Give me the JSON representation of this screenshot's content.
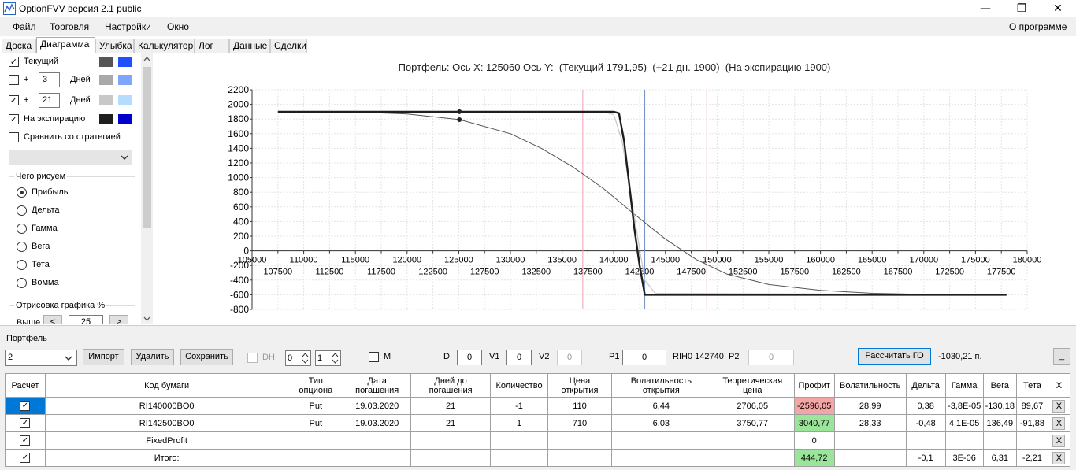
{
  "window": {
    "title": "OptionFVV версия 2.1 public",
    "min": "—",
    "max": "❐",
    "close": "✕"
  },
  "menu": {
    "items": [
      "Файл",
      "Торговля",
      "Настройки",
      "Окно"
    ],
    "about": "О программе"
  },
  "tabs": [
    "Доска",
    "Диаграмма",
    "Улыбка",
    "Калькулятор",
    "Лог",
    "Данные",
    "Сделки"
  ],
  "active_tab": "Диаграмма",
  "left": {
    "current_label": "Текущий",
    "plus": "+",
    "days1": "3",
    "days2": "21",
    "days_label": "Дней",
    "expiry_label": "На экспирацию",
    "compare_label": "Сравнить со стратегией",
    "what_group": "Чего рисуем",
    "radios": [
      "Прибыль",
      "Дельта",
      "Гамма",
      "Вега",
      "Тета",
      "Вомма"
    ],
    "render_group": "Отрисовка графика %",
    "above_label": "Выше",
    "above_value": "25",
    "lt": "<",
    "gt": ">",
    "colors": {
      "current": [
        "#555555",
        "#1f4fff"
      ],
      "d3": [
        "#a9a9a9",
        "#7fa6ff"
      ],
      "d21": [
        "#c8c8c8",
        "#b4dcff"
      ],
      "expiry": [
        "#1e1e1e",
        "#0000cc"
      ]
    }
  },
  "chart_data": {
    "type": "line",
    "title": "Портфель: Ось X: 125060 Ось Y:  (Текущий 1791,95)  (+21 дн. 1900)  (На экспирацию 1900)",
    "xlim": [
      105000,
      180000
    ],
    "ylim": [
      -800,
      2200
    ],
    "x_ticks_upper": [
      105000,
      110000,
      115000,
      120000,
      125000,
      130000,
      135000,
      140000,
      145000,
      150000,
      155000,
      160000,
      165000,
      170000,
      175000,
      180000
    ],
    "x_ticks_lower": [
      107500,
      112500,
      117500,
      122500,
      127500,
      132500,
      137500,
      142500,
      147500,
      152500,
      157500,
      162500,
      167500,
      172500,
      177500
    ],
    "y_ticks": [
      2200,
      2000,
      1800,
      1600,
      1400,
      1200,
      1000,
      800,
      600,
      400,
      200,
      0,
      -200,
      -400,
      -600,
      -800
    ],
    "vlines": [
      {
        "x": 137000,
        "color": "#f4a0b0"
      },
      {
        "x": 143000,
        "color": "#7090c0"
      },
      {
        "x": 149000,
        "color": "#f4a0b0"
      }
    ],
    "series": [
      {
        "color": "#1e1e1e",
        "width": 2.4,
        "x": [
          107500,
          140000,
          140500,
          141000,
          141500,
          142000,
          142500,
          143000,
          178000
        ],
        "y": [
          1900,
          1900,
          1880,
          1500,
          900,
          300,
          -200,
          -600,
          -600
        ]
      },
      {
        "color": "#c8c8c8",
        "width": 1.2,
        "x": [
          107500,
          139000,
          140000,
          140800,
          141500,
          142300,
          143000,
          144000,
          178000
        ],
        "y": [
          1900,
          1900,
          1860,
          1500,
          900,
          200,
          -400,
          -580,
          -600
        ]
      },
      {
        "color": "#555555",
        "width": 1,
        "x": [
          107500,
          115000,
          120000,
          125060,
          130000,
          133000,
          136000,
          139000,
          142000,
          145000,
          148000,
          151000,
          155000,
          160000,
          165000,
          170000,
          178000
        ],
        "y": [
          1900,
          1895,
          1870,
          1792,
          1600,
          1400,
          1150,
          850,
          500,
          160,
          -120,
          -320,
          -460,
          -540,
          -580,
          -595,
          -600
        ]
      }
    ],
    "markers": [
      {
        "x": 125060,
        "y": 1900
      },
      {
        "x": 125060,
        "y": 1792
      }
    ]
  },
  "portfolio": {
    "group_label": "Портфель",
    "selector": "2",
    "import": "Импорт",
    "delete": "Удалить",
    "save": "Сохранить",
    "dh": "DH",
    "spin1": "0",
    "spin2": "1",
    "m": "M",
    "d_label": "D",
    "d_value": "0",
    "v1_label": "V1",
    "v1_value": "0",
    "v2_label": "V2",
    "v2_value": "0",
    "p1_label": "P1",
    "p1_value": "0",
    "ticker": "RIH0 142740",
    "p2_label": "P2",
    "p2_value": "0",
    "calc_go": "Рассчитать ГО",
    "go_value": "-1030,21 п.",
    "minimize": "_"
  },
  "table": {
    "headers": [
      "Расчет",
      "Код бумаги",
      "Тип\nопциона",
      "Дата\nпогашения",
      "Дней до\nпогашения",
      "Количество",
      "Цена\nоткрытия",
      "Волатильность\nоткрытия",
      "Теоретическая\nцена",
      "Профит",
      "Волатильность",
      "Дельта",
      "Гамма",
      "Вега",
      "Тета",
      "X"
    ],
    "rows": [
      {
        "code": "RI140000BO0",
        "type": "Put",
        "date": "19.03.2020",
        "days": "21",
        "qty": "-1",
        "price": "110",
        "vol_open": "6,44",
        "theo": "2706,05",
        "profit": "-2596,05",
        "vol": "28,99",
        "delta": "0,38",
        "gamma": "-3,8E-05",
        "vega": "-130,18",
        "theta": "89,67",
        "x": "X"
      },
      {
        "code": "RI142500BO0",
        "type": "Put",
        "date": "19.03.2020",
        "days": "21",
        "qty": "1",
        "price": "710",
        "vol_open": "6,03",
        "theo": "3750,77",
        "profit": "3040,77",
        "vol": "28,33",
        "delta": "-0,48",
        "gamma": "4,1E-05",
        "vega": "136,49",
        "theta": "-91,88",
        "x": "X"
      },
      {
        "code": "FixedProfit",
        "type": "",
        "date": "",
        "days": "",
        "qty": "",
        "price": "",
        "vol_open": "",
        "theo": "",
        "profit": "0",
        "vol": "",
        "delta": "",
        "gamma": "",
        "vega": "",
        "theta": "",
        "x": "X"
      },
      {
        "code": "Итого:",
        "type": "",
        "date": "",
        "days": "",
        "qty": "",
        "price": "",
        "vol_open": "",
        "theo": "",
        "profit": "444,72",
        "vol": "",
        "delta": "-0,1",
        "gamma": "3E-06",
        "vega": "6,31",
        "theta": "-2,21",
        "x": "X"
      }
    ]
  }
}
